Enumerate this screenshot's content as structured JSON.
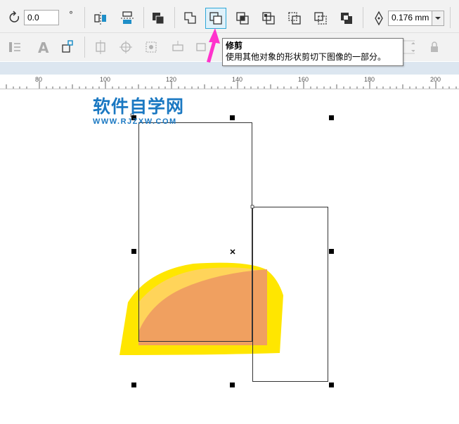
{
  "toolbar": {
    "rotation_value": "0.0",
    "degree_symbol": "°",
    "outline_width": "0.176 mm"
  },
  "tooltip": {
    "title": "修剪",
    "description": "使用其他对象的形状剪切下图像的一部分。"
  },
  "ruler": {
    "labels": [
      "80",
      "100",
      "120",
      "140",
      "160",
      "180",
      "200"
    ]
  },
  "watermark": {
    "title": "软件自学网",
    "url": "WWW.RJZXW.COM"
  },
  "colors": {
    "accent": "#2ea8d8",
    "arrow": "#ff33cc",
    "shape_yellow": "#ffe600",
    "shape_light": "#ffd45a",
    "shape_orange": "#f0a060",
    "watermark_blue": "#1a78c2"
  }
}
